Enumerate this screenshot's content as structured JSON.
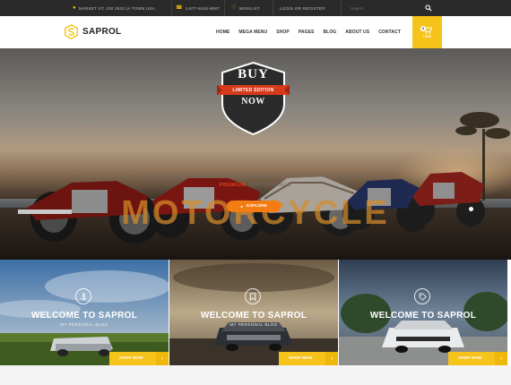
{
  "topbar": {
    "address": "MARKET ST, 100 2633 (A TOWN USA",
    "phone": "1-877-8445-9087",
    "wishlist": "WISHLIST",
    "login": "LOGIN OR REGISTER",
    "search_placeholder": "Search"
  },
  "header": {
    "logo": "SAPROL",
    "nav": [
      "HOME",
      "MEGA MENU",
      "SHOP",
      "PAGES",
      "BLOG",
      "ABOUT US",
      "CONTACT"
    ],
    "cart_count": "0",
    "cart_label": "ITEM"
  },
  "hero": {
    "badge_top": "BUY",
    "badge_ribbon": "LIMITED EDITION",
    "badge_bottom": "NOW",
    "intro": "INTRODUCING A MOTORCYCLE SO ADVANCED IT SETS A NEW STANDART FOR",
    "highlight": "PREMIUM",
    "intro_end": "PERFORMANCE",
    "title": "MOTORCYCLE",
    "button": "EXPLORE"
  },
  "cards": [
    {
      "title": "WELCOME TO SAPROL",
      "subtitle": "MY PERSONAL BLOG",
      "button": "SHOP NOW",
      "icon": "anchor-icon"
    },
    {
      "title": "WELCOME TO SAPROL",
      "subtitle": "MY PERSONAL BLOG",
      "button": "SHOP NOW",
      "icon": "bookmark-icon"
    },
    {
      "title": "WELCOME TO SAPROL",
      "subtitle": "",
      "button": "SHOP NOW",
      "icon": "tags-icon"
    }
  ],
  "colors": {
    "accent": "#f6c31a",
    "orange": "#f47d13",
    "red": "#e2401b",
    "topbar": "#2a2a2a"
  }
}
